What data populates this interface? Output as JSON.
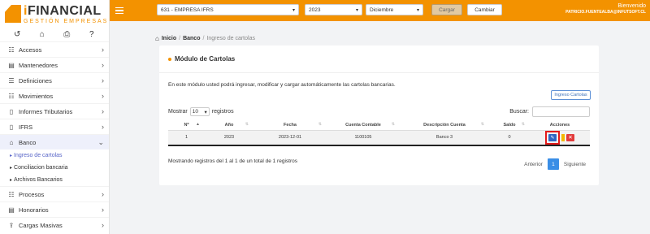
{
  "brand": {
    "name_prefix": "i",
    "name_main": "FINANCIAL",
    "tagline": "GESTIÓN EMPRESAS",
    "accent": "#f39200"
  },
  "quick_icons": [
    "undo-icon",
    "home-icon",
    "print-icon",
    "help-icon"
  ],
  "sidebar": {
    "items": [
      {
        "label": "Accesos",
        "icon": "users-icon"
      },
      {
        "label": "Mantenedores",
        "icon": "briefcase-icon"
      },
      {
        "label": "Definiciones",
        "icon": "list-icon"
      },
      {
        "label": "Movimientos",
        "icon": "users-icon"
      },
      {
        "label": "Informes Tributarios",
        "icon": "document-icon"
      },
      {
        "label": "IFRS",
        "icon": "document-icon"
      },
      {
        "label": "Banco",
        "icon": "bank-icon",
        "expanded": true
      },
      {
        "label": "Procesos",
        "icon": "users-icon"
      },
      {
        "label": "Honorarios",
        "icon": "briefcase-icon"
      },
      {
        "label": "Cargas Masivas",
        "icon": "upload-icon"
      }
    ],
    "banco_sub": [
      {
        "label": "Ingreso de cartolas",
        "active": true
      },
      {
        "label": "Conciliacion bancaria"
      },
      {
        "label": "Archivos Bancarios"
      }
    ]
  },
  "topbar": {
    "empresa": "631 - EMPRESA IFRS",
    "year": "2023",
    "month": "Diciembre",
    "btn_cargar": "Cargar",
    "btn_cambiar": "Cambiar",
    "welcome": "Bienvenido",
    "user": "PATRICIO.FUENTEALBA@INFUTSOFT.CL"
  },
  "breadcrumb": {
    "home": "Inicio",
    "section": "Banco",
    "current": "Ingreso de cartolas"
  },
  "module": {
    "title": "Módulo de Cartolas",
    "description": "En este módulo usted podrá ingresar, modificar y cargar automáticamente las cartolas bancarias.",
    "btn_ingreso": "Ingreso Cartolas",
    "show_prefix": "Mostrar",
    "show_value": "10",
    "show_suffix": "registros",
    "search_label": "Buscar:",
    "columns": [
      "Nº",
      "Año",
      "Fecha",
      "Cuenta Contable",
      "Descripción Cuenta",
      "Saldo",
      "Acciones"
    ],
    "rows": [
      [
        "1",
        "2023",
        "2023-12-01",
        "1100105",
        "Banco 3",
        "0"
      ]
    ],
    "info": "Mostrando registros del 1 al 1 de un total de 1 registros",
    "pager": {
      "prev": "Anterior",
      "page": "1",
      "next": "Siguiente"
    }
  }
}
